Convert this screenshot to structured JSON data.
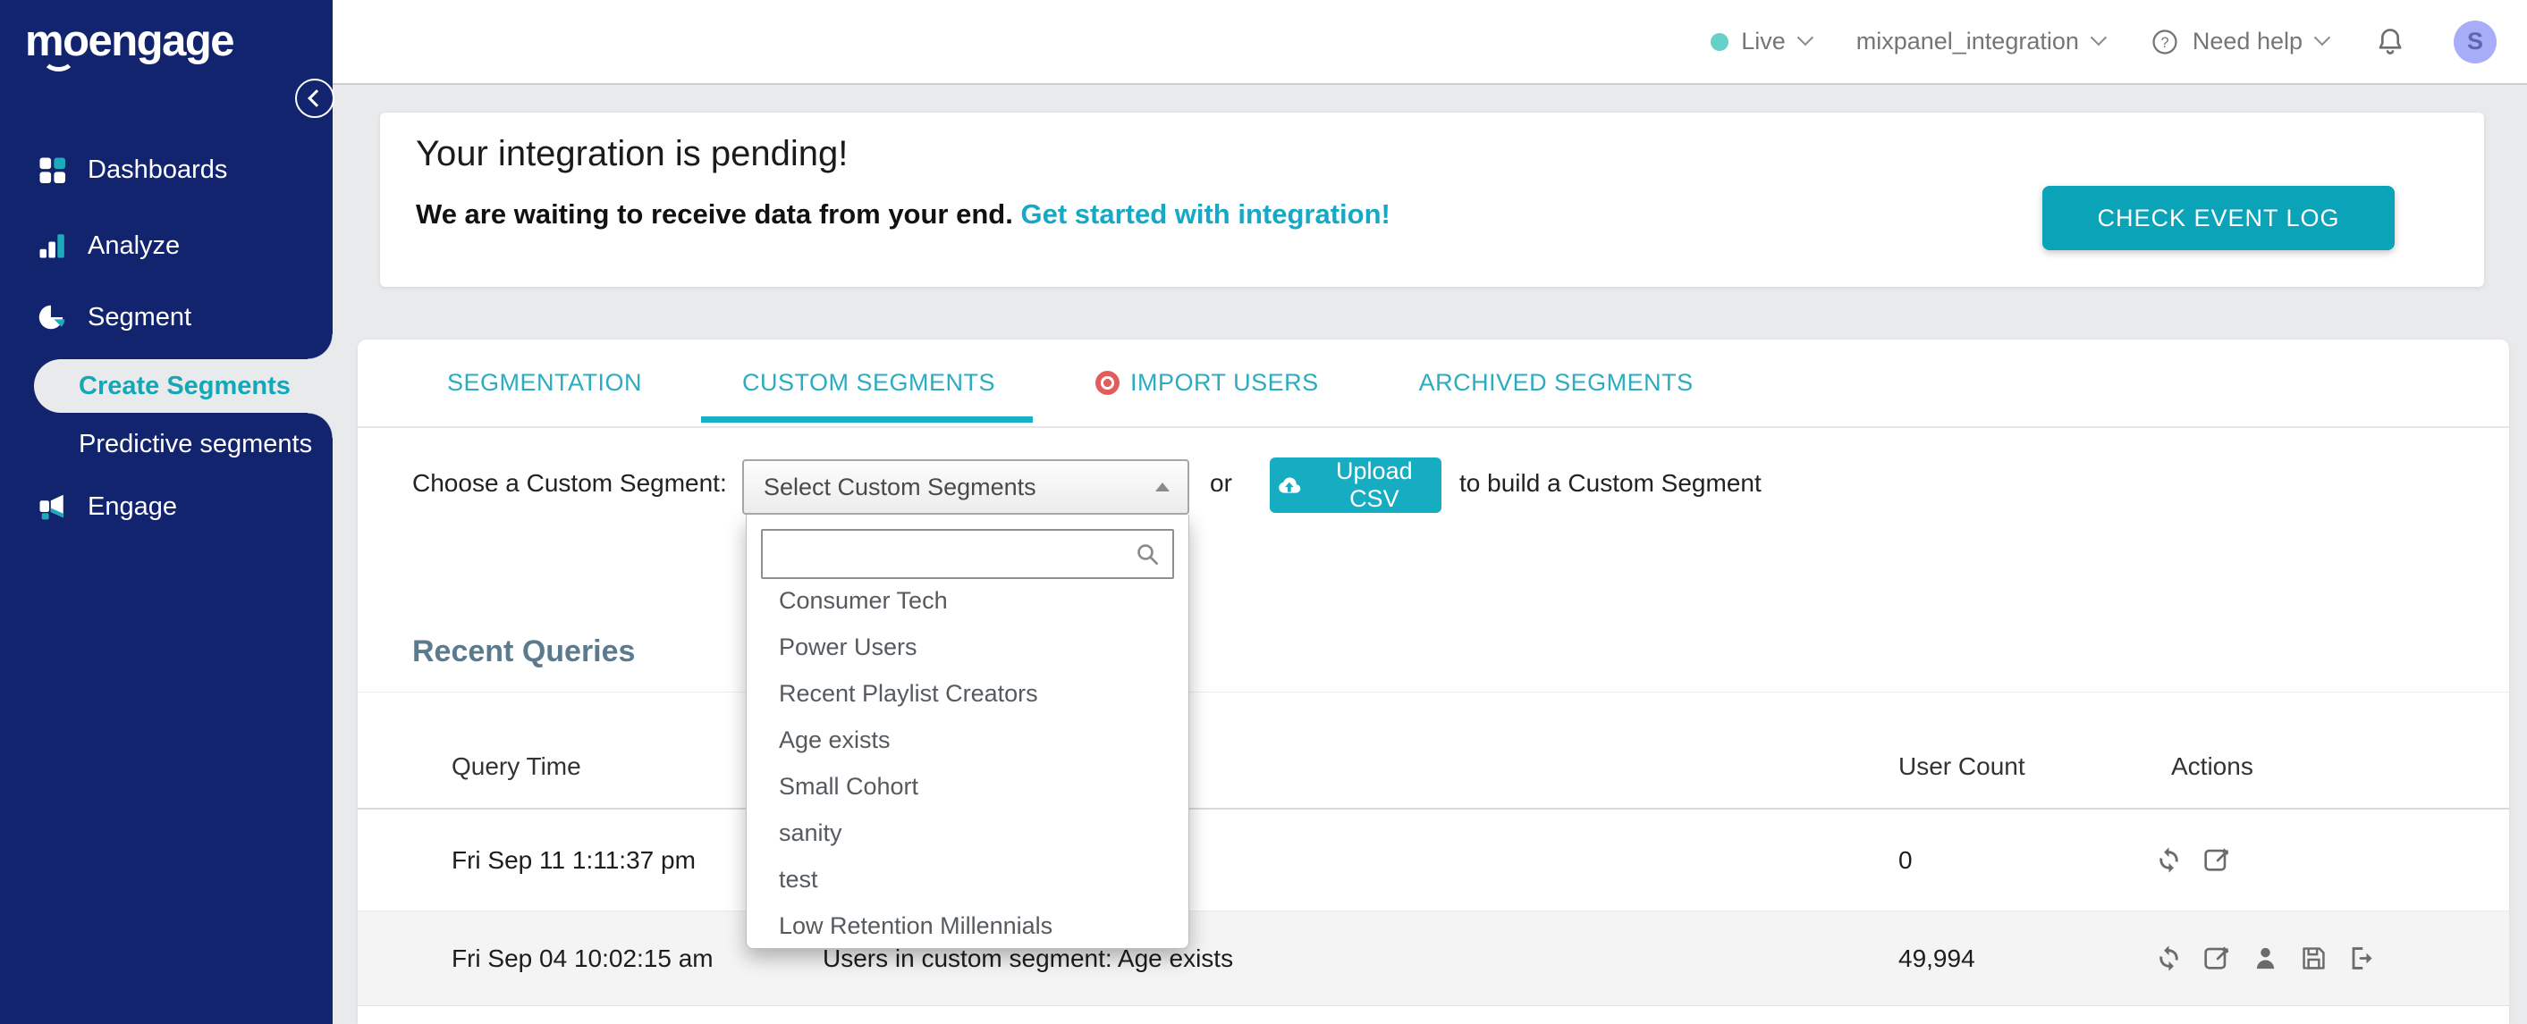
{
  "colors": {
    "sidebar_navy": "#13246E",
    "accent_teal": "#12A6BB",
    "page_bg": "#E9EAEB",
    "import_icon_red": "#E25C5C",
    "live_dot_teal": "#66D1C6",
    "avatar_bg": "#A7ADF6",
    "heading_slate": "#5C7A8E"
  },
  "header": {
    "live_label": "Live",
    "project_name": "mixpanel_integration",
    "help_glyph": "?",
    "help_label": "Need help",
    "avatar_initial": "S"
  },
  "sidebar": {
    "logo_text": "moengage",
    "items": [
      {
        "label": "Dashboards"
      },
      {
        "label": "Analyze"
      },
      {
        "label": "Segment"
      },
      {
        "label": "Create Segments"
      },
      {
        "label": "Predictive segments"
      },
      {
        "label": "Engage"
      }
    ]
  },
  "banner": {
    "title": "Your integration is pending!",
    "message": "We are waiting to receive data from your end.",
    "link_label": "Get started with integration!",
    "button_label": "CHECK EVENT LOG"
  },
  "tabs": [
    {
      "label": "SEGMENTATION"
    },
    {
      "label": "CUSTOM SEGMENTS"
    },
    {
      "label": "IMPORT USERS"
    },
    {
      "label": "ARCHIVED SEGMENTS"
    }
  ],
  "active_tab": "CUSTOM SEGMENTS",
  "picker": {
    "label": "Choose a Custom Segment:",
    "select_value": "Select Custom Segments",
    "or_label": "or",
    "upload_button_label": "Upload CSV",
    "suffix_label": "to build a Custom Segment",
    "search_value": "",
    "options": [
      "Consumer Tech",
      "Power Users",
      "Recent Playlist Creators",
      "Age exists",
      "Small Cohort",
      "sanity",
      "test",
      "Low Retention Millennials"
    ]
  },
  "recent_queries": {
    "title": "Recent Queries",
    "columns": {
      "query_time": "Query Time",
      "user_count": "User Count",
      "actions": "Actions"
    },
    "rows": [
      {
        "query_time": "Fri Sep 11 1:11:37 pm",
        "description": "",
        "user_count": "0"
      },
      {
        "query_time": "Fri Sep 04 10:02:15 am",
        "description": "Users in custom segment: Age exists",
        "user_count": "49,994"
      }
    ]
  }
}
